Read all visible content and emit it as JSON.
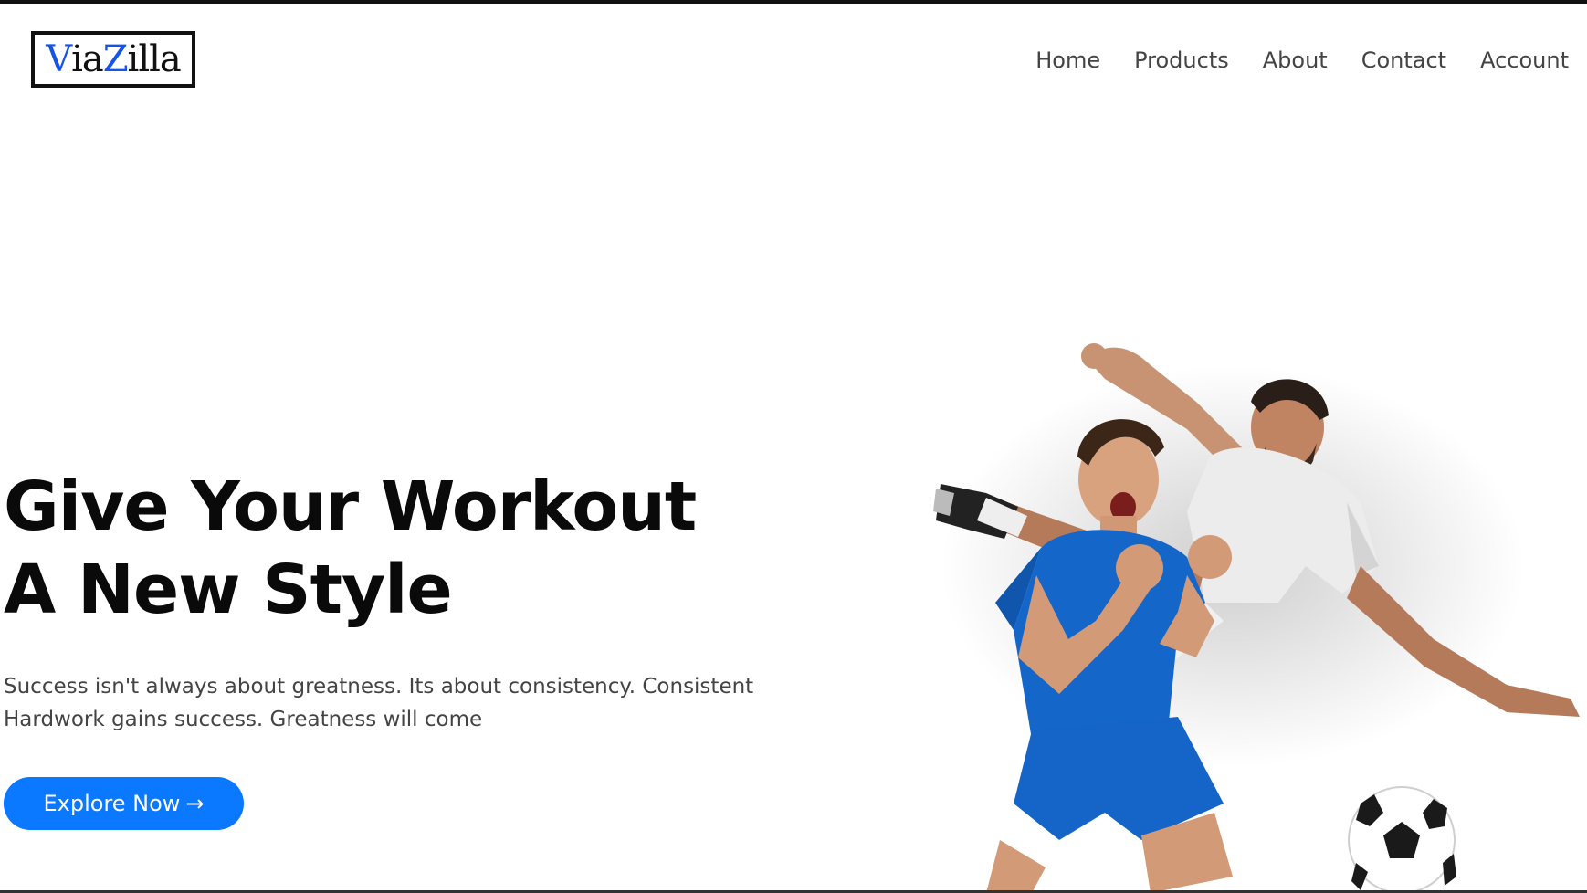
{
  "brand": {
    "logo_part_1": "V",
    "logo_part_2": "ia",
    "logo_part_3": "Z",
    "logo_part_4": "illa",
    "accent_color": "#1454e6"
  },
  "nav": {
    "items": [
      {
        "label": "Home"
      },
      {
        "label": "Products"
      },
      {
        "label": "About"
      },
      {
        "label": "Contact"
      },
      {
        "label": "Account"
      }
    ]
  },
  "hero": {
    "headline_line_1": "Give Your Workout",
    "headline_line_2": "A New Style",
    "tagline_line_1": "Success isn't always about greatness. Its about consistency. Consistent",
    "tagline_line_2": "Hardwork gains success. Greatness will come",
    "cta_label": "Explore Now",
    "cta_icon": "→",
    "cta_color": "#0a78ff"
  }
}
